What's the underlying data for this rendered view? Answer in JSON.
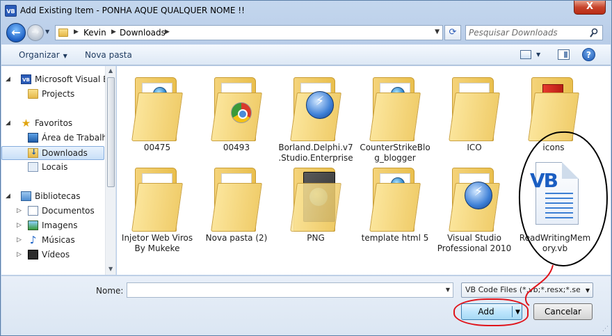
{
  "window": {
    "title": "Add Existing Item - PONHA AQUE QUALQUER NOME !!",
    "app_icon": "VB",
    "close_label": "X"
  },
  "address": {
    "crumbs": [
      "Kevin",
      "Downloads"
    ],
    "search_placeholder": "Pesquisar Downloads"
  },
  "toolbar": {
    "organize_label": "Organizar",
    "new_folder_label": "Nova pasta",
    "help_label": "?"
  },
  "nav": {
    "items": [
      {
        "label": "Microsoft Visual Ba",
        "icon": "vb-project-icon"
      },
      {
        "label": "Projects",
        "icon": "folder-icon"
      },
      {
        "label": "Favoritos",
        "icon": "star-icon"
      },
      {
        "label": "Área de Trabalho",
        "icon": "desktop-icon"
      },
      {
        "label": "Downloads",
        "icon": "downloads-icon"
      },
      {
        "label": "Locais",
        "icon": "places-icon"
      },
      {
        "label": "Bibliotecas",
        "icon": "library-icon"
      },
      {
        "label": "Documentos",
        "icon": "documents-icon"
      },
      {
        "label": "Imagens",
        "icon": "pictures-icon"
      },
      {
        "label": "Músicas",
        "icon": "music-icon"
      },
      {
        "label": "Vídeos",
        "icon": "video-icon"
      }
    ]
  },
  "files": [
    {
      "label": "00475",
      "kind": "folder"
    },
    {
      "label": "00493",
      "kind": "folder-chrome"
    },
    {
      "label": "Borland.Delphi.v7.Studio.Enterprise",
      "kind": "folder-lightning"
    },
    {
      "label": "CounterStrikeBlog_blogger",
      "kind": "folder-globe"
    },
    {
      "label": "ICO",
      "kind": "folder"
    },
    {
      "label": "icons",
      "kind": "folder-red"
    },
    {
      "label": "Injetor Web Viros By Mukeke",
      "kind": "folder"
    },
    {
      "label": "Nova pasta (2)",
      "kind": "folder"
    },
    {
      "label": "PNG",
      "kind": "folder-png"
    },
    {
      "label": "template html 5",
      "kind": "folder-globe"
    },
    {
      "label": "Visual Studio Professional 2010",
      "kind": "folder-lightning"
    },
    {
      "label": "ReadWritingMemory.vb",
      "kind": "vb-file"
    }
  ],
  "vb_glyph": "VB",
  "bottom": {
    "name_label": "Nome:",
    "name_value": "",
    "filter_label": "VB Code Files (*.vb;*.resx;*.setti",
    "add_label": "Add",
    "cancel_label": "Cancelar"
  },
  "colors": {
    "annotation_black": "#000000",
    "annotation_red": "#e0141b",
    "accent": "#2a5bb8"
  }
}
